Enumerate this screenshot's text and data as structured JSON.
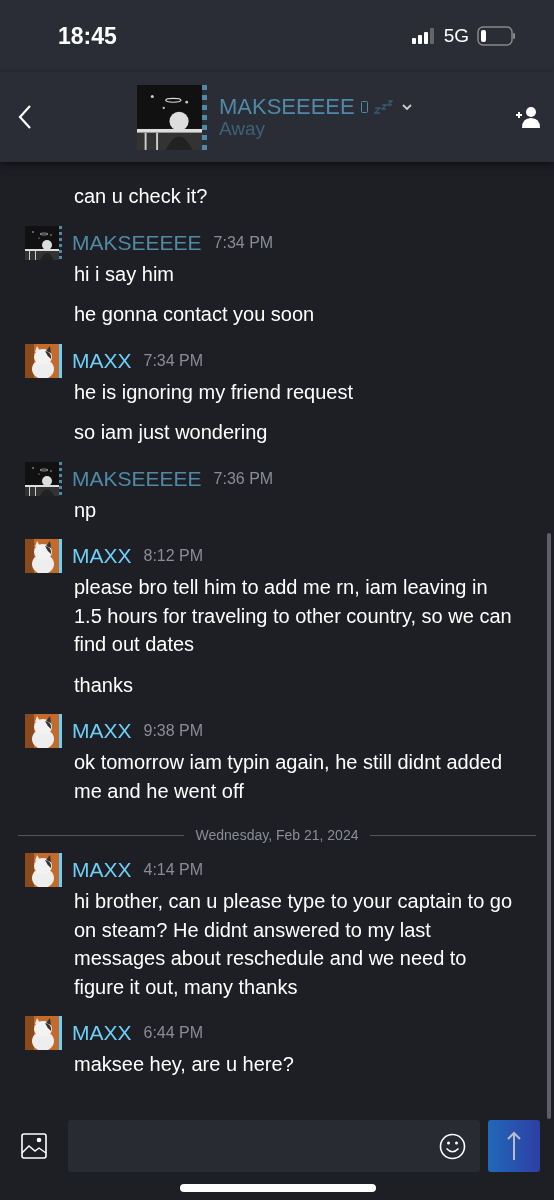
{
  "status_bar": {
    "time": "18:45",
    "network": "5G"
  },
  "header": {
    "name": "MAKSEEEEE",
    "away": true,
    "status_text": "Away"
  },
  "messages": [
    {
      "kind": "continued",
      "lines": [
        "can u check it?"
      ]
    },
    {
      "kind": "group",
      "sender": "MAKSEEEEE",
      "away": true,
      "time": "7:34 PM",
      "lines": [
        "hi i say him",
        "he gonna contact you soon"
      ]
    },
    {
      "kind": "group",
      "sender": "MAXX",
      "away": false,
      "time": "7:34 PM",
      "lines": [
        "he is ignoring my friend request",
        "so iam just wondering"
      ]
    },
    {
      "kind": "group",
      "sender": "MAKSEEEEE",
      "away": true,
      "time": "7:36 PM",
      "lines": [
        "np"
      ]
    },
    {
      "kind": "group",
      "sender": "MAXX",
      "away": false,
      "time": "8:12 PM",
      "lines": [
        "please bro tell him to add me rn, iam leaving in 1.5 hours for traveling to other country, so we can find out dates",
        "thanks"
      ]
    },
    {
      "kind": "group",
      "sender": "MAXX",
      "away": false,
      "time": "9:38 PM",
      "lines": [
        "ok tomorrow iam typin again, he still didnt added me and he went off"
      ]
    },
    {
      "kind": "date",
      "text": "Wednesday, Feb 21, 2024"
    },
    {
      "kind": "group",
      "sender": "MAXX",
      "away": false,
      "time": "4:14 PM",
      "lines": [
        "hi brother, can u please type to your captain to go on steam? He didnt answered to my last messages about reschedule and we need to figure it out, many thanks"
      ]
    },
    {
      "kind": "group",
      "sender": "MAXX",
      "away": false,
      "time": "6:44 PM",
      "lines": [
        "maksee hey, are u here?"
      ]
    }
  ]
}
